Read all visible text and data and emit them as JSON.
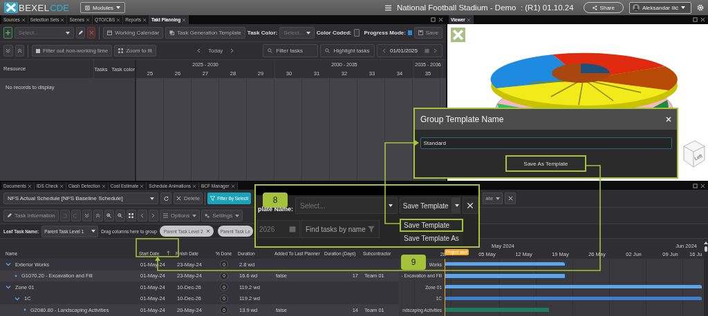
{
  "header": {
    "logo_main": "BEXEL",
    "logo_accent": "CDE",
    "modules_button": "Modules",
    "project_title": "National Football Stadium - Demo  : (R1) 01.10.24",
    "share_button": "Share",
    "user_name": "Aleksandar Ilić"
  },
  "takt_panel": {
    "tabs": [
      {
        "label": "Sources",
        "selected": false
      },
      {
        "label": "Selection Sets",
        "selected": false
      },
      {
        "label": "Scenes",
        "selected": false
      },
      {
        "label": "QTO/CBS",
        "selected": false
      },
      {
        "label": "Reports",
        "selected": false
      },
      {
        "label": "Takt Planning",
        "selected": true
      }
    ],
    "toolbar": {
      "select_placeholder": "Select...",
      "working_calendar_button": "Working Calendar",
      "task_generation_template_button": "Task Generation Template",
      "task_color_label": "Task Color:",
      "task_color_placeholder": "Select...",
      "color_coded_label": "Color Coded:",
      "color_coded": false,
      "progress_mode_label": "Progress Mode:",
      "progress_mode": true,
      "save_button": "Save"
    },
    "timeline_toolbar": {
      "filter_non_working": {
        "label": "Filter out non-working time",
        "checked": false
      },
      "zoom_to_fit_button": "Zoom to fit",
      "today_button": "Today",
      "filter_tasks_placeholder": "Filter tasks",
      "highlight_tasks_placeholder": "Highlight tasks",
      "date": "01/01/2025"
    },
    "grid": {
      "columns": [
        "Resource",
        "Tasks",
        "Task color"
      ],
      "periods": [
        {
          "label": "2025 - 2030",
          "units": [
            "25",
            "26",
            "27",
            "28",
            "29"
          ]
        },
        {
          "label": "2030 - 2035",
          "units": [
            "30",
            "31",
            "32",
            "33",
            "34"
          ]
        },
        {
          "label": "2035 - 2036",
          "units": [
            "35"
          ]
        }
      ],
      "empty_message": "No records to display"
    }
  },
  "viewer": {
    "tab": "Viewer",
    "view_cube_face": "Left"
  },
  "schedule_panel": {
    "tabs": [
      {
        "label": "Documents",
        "selected": false
      },
      {
        "label": "IDS Check",
        "selected": false
      },
      {
        "label": "Clash Detection",
        "selected": false
      },
      {
        "label": "Cost Estimate",
        "selected": false
      },
      {
        "label": "Schedule Animations",
        "selected": false
      },
      {
        "label": "BCF Manager",
        "selected": false
      }
    ],
    "toolbar": {
      "schedule": "NFS Actual Schedule [NFS Baseline Schedule]",
      "delete_button": "Delete",
      "filter_by_selection_button": "Filter By Selecti",
      "template_button_fragment": "ate"
    },
    "task_toolbar": {
      "task_information_button": "Task Information",
      "options_button": "Options",
      "settings_button": "Settings"
    },
    "grouping": {
      "leaf_task_label": "Leaf Task Name:",
      "leaf_task_value": "Parent Task Level 1",
      "drop_hint": "Drag columns here to group",
      "group_chips": [
        "Parent Task Level 2",
        "Parent Task Le"
      ]
    },
    "columns": [
      {
        "label": "Name",
        "sorted": false
      },
      {
        "label": "Start Date",
        "sorted": true
      },
      {
        "label": "Finish Date",
        "sorted": false
      },
      {
        "label": "% Done",
        "sorted": false
      },
      {
        "label": "Duration",
        "sorted": false
      },
      {
        "label": "Added To Last Planner",
        "sorted": false
      },
      {
        "label": "Duration (Days)",
        "sorted": false
      },
      {
        "label": "Subcontractor",
        "sorted": false
      }
    ],
    "rows": [
      {
        "kind": "group",
        "name": "Exterior Works",
        "expanded": true,
        "start": "01-May-24",
        "finish": "23-May-24",
        "done": "0",
        "duration": "2.8 wd",
        "color": "#5aa5ec",
        "children": [
          {
            "kind": "task",
            "name": "G1070.20 - Excavation and Fill",
            "start": "01-May-24",
            "finish": "23-May-24",
            "done": "0",
            "duration": "16.6 wd",
            "added_to_last_planner": "false",
            "duration_days": "17",
            "subcontractor": "Team 01",
            "color": "#5aa5ec"
          }
        ]
      },
      {
        "kind": "group",
        "name": "Zone 01",
        "expanded": true,
        "start": "01-May-24",
        "finish": "10-Dec-26",
        "done": "0",
        "duration": "119.2 wd",
        "color": "#5aa5ec",
        "children": [
          {
            "kind": "group",
            "name": "1C",
            "expanded": true,
            "start": "01-May-24",
            "finish": "10-Dec-26",
            "done": "0",
            "duration": "119.2 wd",
            "color": "#3f7fcf",
            "children": [
              {
                "kind": "task",
                "name": "G2080.80 - Landscaping Activities",
                "start": "01-May-24",
                "finish": "20-May-24",
                "done": "0",
                "duration": "13.9 wd",
                "added_to_last_planner": "false",
                "duration_days": "14",
                "subcontractor": "Team 01",
                "color": "#1f7a5c"
              }
            ]
          }
        ]
      }
    ],
    "gantt": {
      "months": [
        "May 2024",
        "Jun 2024"
      ],
      "weeks": [
        "28",
        "05 May",
        "12 May",
        "19 May",
        "26 May",
        "02 Jun",
        "09 Jun",
        "16 Ju"
      ],
      "project_start": "Project start",
      "labels": [
        "Works",
        "- Excavation and Fill",
        "Zone 01",
        "1C",
        "ndscaping Activities"
      ]
    }
  },
  "callout_inset": {
    "template_name_label": "plate Name:",
    "template_select_placeholder": "Select...",
    "save_template_button": "Save Template",
    "template_menu": [
      {
        "label": "Save Template",
        "selected": true
      },
      {
        "label": "Save Template As",
        "selected": false
      }
    ],
    "date_fragment": "2026",
    "find_tasks_placeholder": "Find tasks by name"
  },
  "dialog": {
    "title": "Group Template Name",
    "template_name": "Standard",
    "save_button": "Save As Template"
  },
  "step_badges": [
    "8",
    "9"
  ]
}
